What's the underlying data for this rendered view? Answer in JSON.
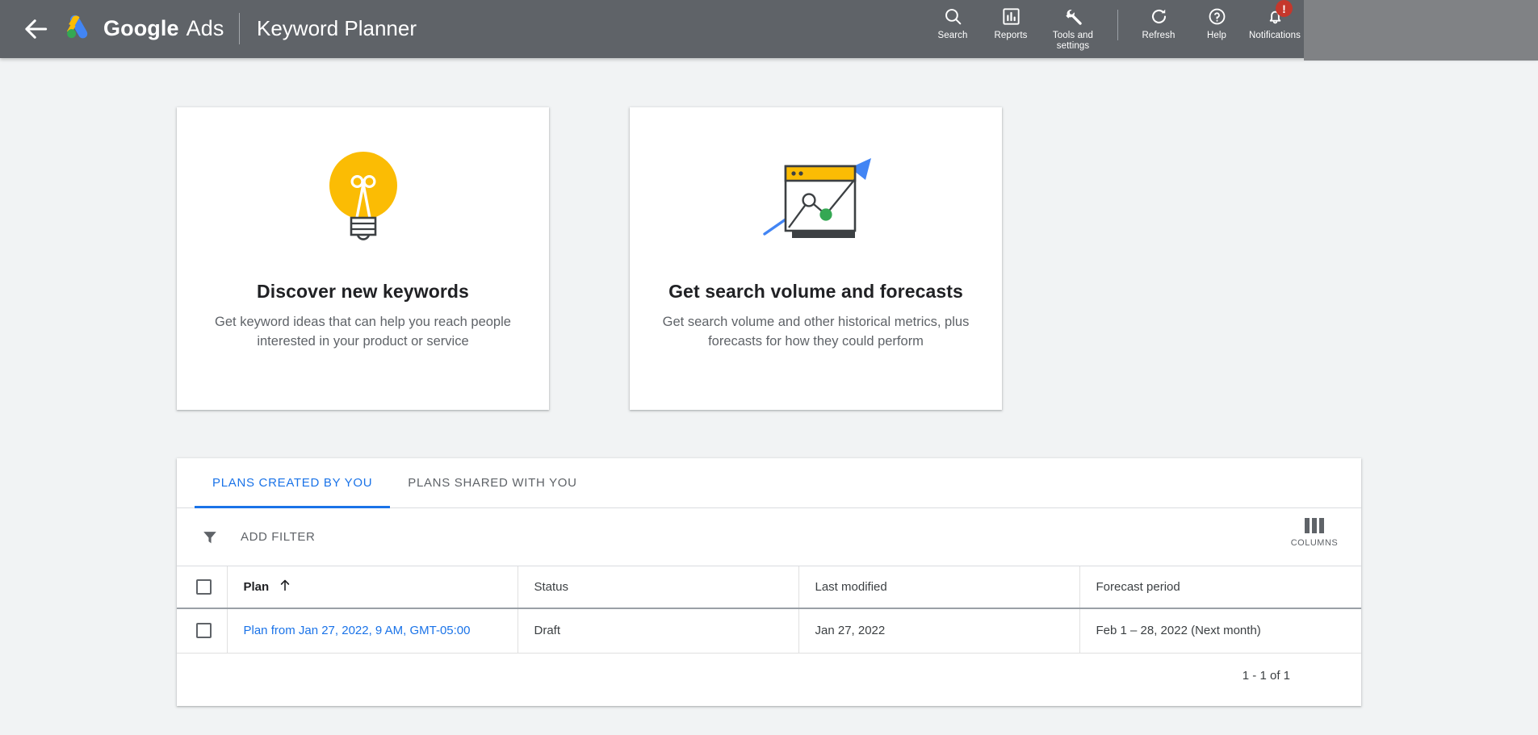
{
  "header": {
    "back_icon": "back-arrow-icon",
    "logo_icon": "google-ads-logo",
    "brand_google": "Google",
    "brand_ads": "Ads",
    "product": "Keyword Planner",
    "tools": [
      {
        "label": "Search",
        "icon": "search-icon"
      },
      {
        "label": "Reports",
        "icon": "reports-icon"
      },
      {
        "label": "Tools and settings",
        "icon": "wrench-icon"
      },
      {
        "label": "Refresh",
        "icon": "refresh-icon"
      },
      {
        "label": "Help",
        "icon": "help-icon"
      },
      {
        "label": "Notifications",
        "icon": "bell-icon",
        "badge": "!"
      }
    ]
  },
  "cards": [
    {
      "icon": "lightbulb-icon",
      "title": "Discover new keywords",
      "description": "Get keyword ideas that can help you reach people interested in your product or service"
    },
    {
      "icon": "forecast-chart-icon",
      "title": "Get search volume and forecasts",
      "description": "Get search volume and other historical metrics, plus forecasts for how they could perform"
    }
  ],
  "plans_panel": {
    "tabs": [
      {
        "label": "PLANS CREATED BY YOU",
        "active": true
      },
      {
        "label": "PLANS SHARED WITH YOU",
        "active": false
      }
    ],
    "filter": {
      "icon": "funnel-icon",
      "label": "ADD FILTER"
    },
    "columns": {
      "icon": "columns-icon",
      "label": "COLUMNS"
    },
    "table": {
      "columns": [
        "Plan",
        "Status",
        "Last modified",
        "Forecast period"
      ],
      "sorted_column": "Plan",
      "sort_direction": "ascending",
      "sort_icon": "arrow-up-icon",
      "rows": [
        {
          "plan": "Plan from Jan 27, 2022, 9 AM, GMT-05:00",
          "status": "Draft",
          "last_modified": "Jan 27, 2022",
          "forecast_period": "Feb 1 – 28, 2022 (Next month)"
        }
      ]
    },
    "pagination": "1 - 1 of 1"
  },
  "colors": {
    "header_bg": "#5f6368",
    "page_bg": "#f1f3f4",
    "accent_blue": "#1a73e8",
    "logo_yellow": "#fbbc04",
    "logo_blue": "#4285f4",
    "logo_green": "#34a853",
    "badge_red": "#c5372c"
  }
}
